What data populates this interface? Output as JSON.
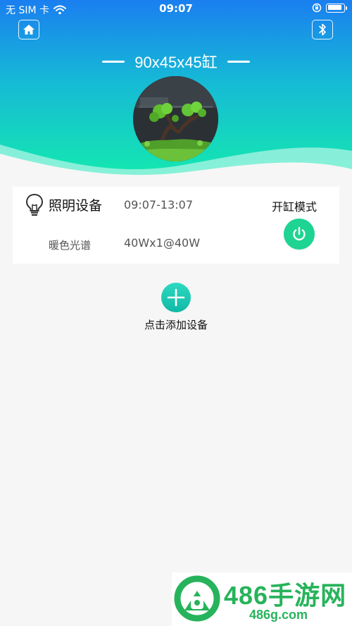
{
  "status_bar": {
    "carrier": "无 SIM 卡",
    "time": "09:07"
  },
  "header": {
    "title": "90x45x45缸",
    "gradient_top": "#1a7ff0",
    "gradient_bottom": "#13e6b6"
  },
  "device": {
    "name": "照明设备",
    "schedule": "09:07-13:07",
    "spectrum": "暖色光谱",
    "power": "40Wx1@40W",
    "mode_label": "开缸模式",
    "icon": "lightbulb-icon",
    "power_color": "#1dd493"
  },
  "add_device": {
    "label": "点击添加设备",
    "icon": "plus-icon"
  },
  "watermark": {
    "title": "486手游网",
    "domain": "486g.com"
  },
  "icons": {
    "home": "home-icon",
    "bluetooth": "bluetooth-icon",
    "wifi": "wifi-icon",
    "orientation_lock": "orientation-lock-icon",
    "battery": "battery-icon"
  }
}
